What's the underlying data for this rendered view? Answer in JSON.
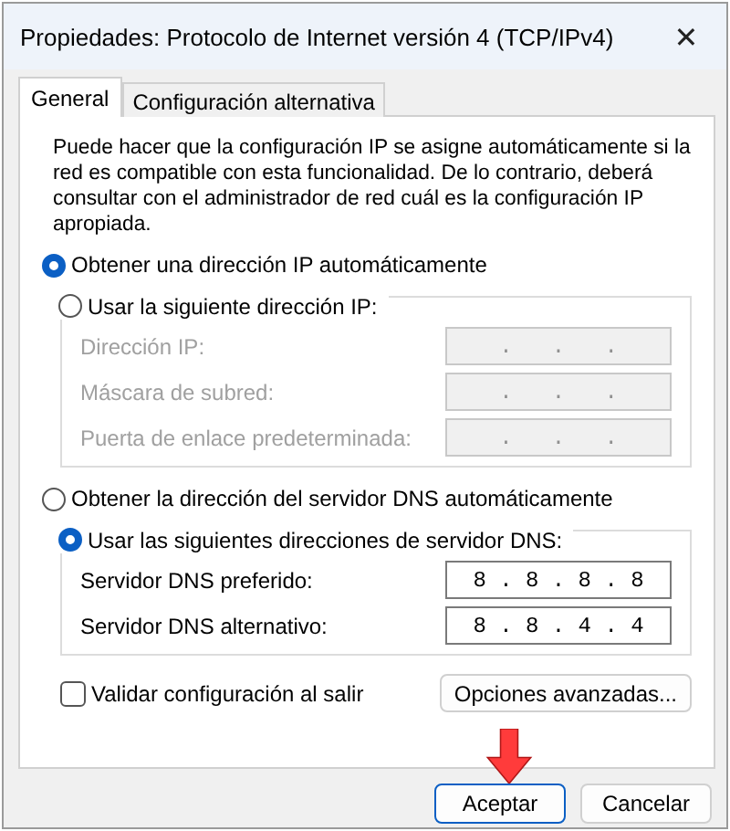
{
  "window": {
    "title": "Propiedades: Protocolo de Internet versión 4 (TCP/IPv4)",
    "close": "✕"
  },
  "tabs": [
    {
      "label": "General",
      "selected": true
    },
    {
      "label": "Configuración alternativa",
      "selected": false
    }
  ],
  "description": "Puede hacer que la configuración IP se asigne automáticamente si la red es compatible con esta funcionalidad. De lo contrario, deberá consultar con el administrador de red cuál es la configuración IP apropiada.",
  "ip": {
    "auto_option": {
      "label": "Obtener una dirección IP automáticamente",
      "selected": true
    },
    "manual_option": {
      "label": "Usar la siguiente dirección IP:",
      "selected": false
    },
    "fields": [
      {
        "label": "Dirección IP:",
        "value": ".   .   .",
        "disabled": true
      },
      {
        "label": "Máscara de subred:",
        "value": ".   .   .",
        "disabled": true
      },
      {
        "label": "Puerta de enlace predeterminada:",
        "value": ".   .   .",
        "disabled": true
      }
    ]
  },
  "dns": {
    "auto_option": {
      "label": "Obtener la dirección del servidor DNS automáticamente",
      "selected": false
    },
    "manual_option": {
      "label": "Usar las siguientes direcciones de servidor DNS:",
      "selected": true
    },
    "fields": [
      {
        "label": "Servidor DNS preferido:",
        "value": "8 . 8 . 8 . 8",
        "disabled": false
      },
      {
        "label": "Servidor DNS alternativo:",
        "value": "8 . 8 . 4 . 4",
        "disabled": false
      }
    ]
  },
  "validate": {
    "label": "Validar configuración al salir",
    "checked": false
  },
  "advanced_button": "Opciones avanzadas...",
  "buttons": [
    {
      "label": "Aceptar",
      "default": true
    },
    {
      "label": "Cancelar",
      "default": false
    }
  ]
}
